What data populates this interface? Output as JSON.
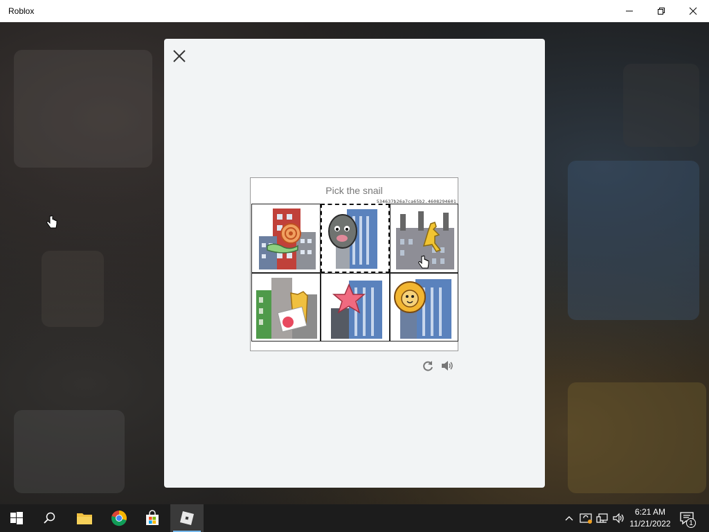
{
  "window": {
    "title": "Roblox",
    "controls": [
      "minimize-icon",
      "restore-icon",
      "close-icon"
    ]
  },
  "captcha": {
    "prompt": "Pick the snail",
    "session_code": "534637b26a7ca65b2.4608294601",
    "tiles": [
      {
        "index": 1,
        "content": "snail on red building",
        "selected": false
      },
      {
        "index": 2,
        "content": "gray creature on blue building",
        "selected": true
      },
      {
        "index": 3,
        "content": "yellow kangaroo on factory",
        "selected": false
      },
      {
        "index": 4,
        "content": "yellow object on green building",
        "selected": false
      },
      {
        "index": 5,
        "content": "pink starfish on blue building",
        "selected": false
      },
      {
        "index": 6,
        "content": "lion head on blue building",
        "selected": false
      }
    ],
    "tools": [
      "reload-icon",
      "audio-icon"
    ]
  },
  "taskbar": {
    "apps": [
      "start-icon",
      "search-icon",
      "chrome-icon",
      "file-explorer-icon",
      "microsoft-store-icon",
      "roblox-icon"
    ],
    "active_app": "roblox-icon",
    "tray": [
      "chevron-up-icon",
      "sync-icon",
      "network-icon",
      "volume-icon"
    ],
    "time": "6:21 AM",
    "date": "11/21/2022",
    "notification_count": "1"
  },
  "colors": {
    "taskbar_bg": "#1c1c1c",
    "modal_bg": "#f2f4f5",
    "active_indicator": "#76b9ed"
  }
}
